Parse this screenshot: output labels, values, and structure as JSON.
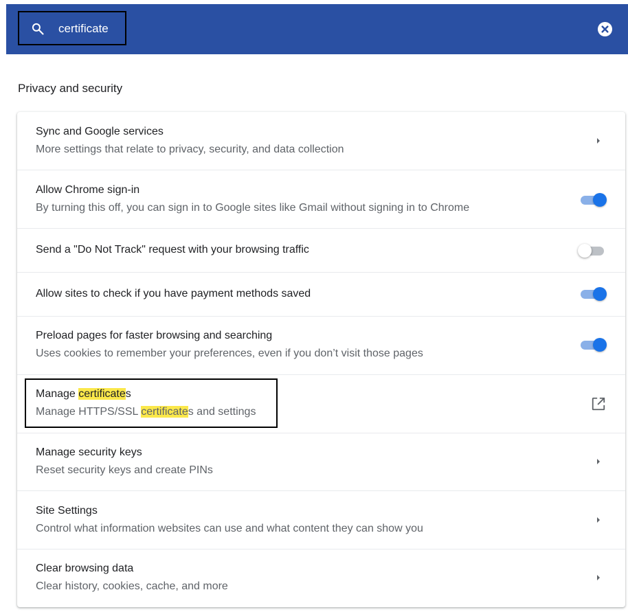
{
  "search": {
    "query": "certificate"
  },
  "section_title": "Privacy and security",
  "rows": [
    {
      "title": "Sync and Google services",
      "subtitle": "More settings that relate to privacy, security, and data collection",
      "control": "arrow"
    },
    {
      "title": "Allow Chrome sign-in",
      "subtitle": "By turning this off, you can sign in to Google sites like Gmail without signing in to Chrome",
      "control": "toggle",
      "checked": true
    },
    {
      "title": "Send a \"Do Not Track\" request with your browsing traffic",
      "control": "toggle",
      "checked": false
    },
    {
      "title": "Allow sites to check if you have payment methods saved",
      "control": "toggle",
      "checked": true
    },
    {
      "title": "Preload pages for faster browsing and searching",
      "subtitle": "Uses cookies to remember your preferences, even if you don’t visit those pages",
      "control": "toggle",
      "checked": true
    },
    {
      "title_parts": [
        "Manage ",
        "certificate",
        "s"
      ],
      "subtitle_parts": [
        "Manage HTTPS/SSL ",
        "certificate",
        "s and settings"
      ],
      "control": "external-link"
    },
    {
      "title": "Manage security keys",
      "subtitle": "Reset security keys and create PINs",
      "control": "arrow"
    },
    {
      "title": "Site Settings",
      "subtitle": "Control what information websites can use and what content they can show you",
      "control": "arrow"
    },
    {
      "title": "Clear browsing data",
      "subtitle": "Clear history, cookies, cache, and more",
      "control": "arrow"
    }
  ],
  "icons": {
    "search": "search-icon",
    "clear": "clear-search-icon",
    "arrow": "chevron-right-icon",
    "external": "open-in-new-icon"
  },
  "colors": {
    "header": "#2a50a3",
    "toggle_on": "#1a73e8",
    "highlight": "#fbe84a"
  }
}
